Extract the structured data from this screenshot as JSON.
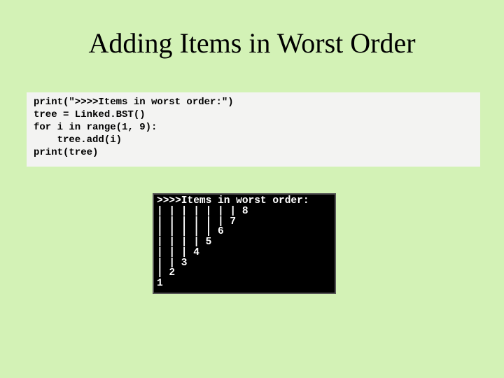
{
  "title": "Adding Items in Worst Order",
  "code": "print(\">>>>Items in worst order:\")\ntree = Linked.BST()\nfor i in range(1, 9):\n    tree.add(i)\nprint(tree)",
  "console": ">>>>Items in worst order:\n| | | | | | | 8\n| | | | | | 7\n| | | | | 6\n| | | | 5\n| | | 4\n| | 3\n| 2\n1"
}
